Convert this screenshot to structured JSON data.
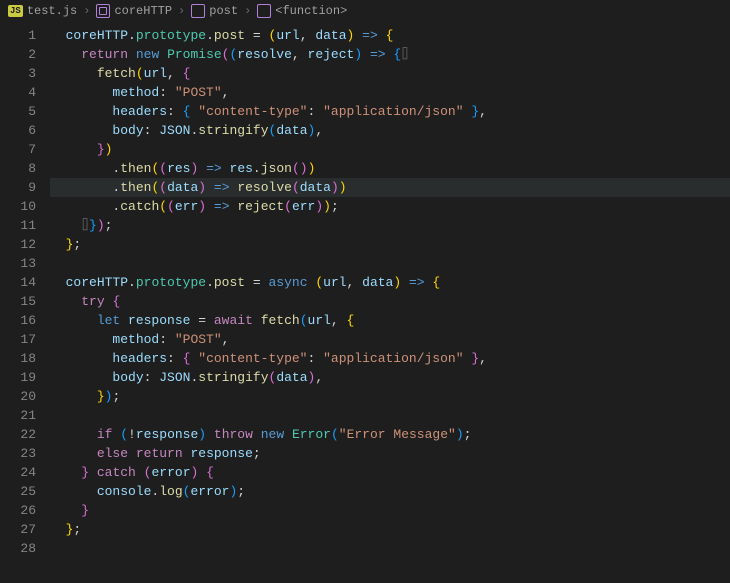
{
  "breadcrumbs": {
    "file": "test.js",
    "class": "coreHTTP",
    "method": "post",
    "fn": "<function>"
  },
  "lines": [
    "1",
    "2",
    "3",
    "4",
    "5",
    "6",
    "7",
    "8",
    "9",
    "10",
    "11",
    "12",
    "13",
    "14",
    "15",
    "16",
    "17",
    "18",
    "19",
    "20",
    "21",
    "22",
    "23",
    "24",
    "25",
    "26",
    "27",
    "28"
  ],
  "code": {
    "l1": {
      "pre": "  ",
      "tokens": [
        [
          "c-var",
          "coreHTTP"
        ],
        [
          "c-punc",
          "."
        ],
        [
          "c-type",
          "prototype"
        ],
        [
          "c-punc",
          "."
        ],
        [
          "c-fn",
          "post"
        ],
        [
          "c-op",
          " = "
        ],
        [
          "c-paren",
          "("
        ],
        [
          "c-var",
          "url"
        ],
        [
          "c-punc",
          ", "
        ],
        [
          "c-var",
          "data"
        ],
        [
          "c-paren",
          ")"
        ],
        [
          "c-kw",
          " => "
        ],
        [
          "c-paren",
          "{"
        ]
      ]
    },
    "l2": {
      "pre": "    ",
      "tokens": [
        [
          "c-ctrl",
          "return"
        ],
        [
          "c-op",
          " "
        ],
        [
          "c-kw",
          "new"
        ],
        [
          "c-op",
          " "
        ],
        [
          "c-type",
          "Promise"
        ],
        [
          "c-paren2",
          "("
        ],
        [
          "c-paren3",
          "("
        ],
        [
          "c-var",
          "resolve"
        ],
        [
          "c-punc",
          ", "
        ],
        [
          "c-var",
          "reject"
        ],
        [
          "c-paren3",
          ")"
        ],
        [
          "c-kw",
          " => "
        ],
        [
          "c-paren3",
          "{"
        ],
        [
          "hint",
          "⌷"
        ]
      ]
    },
    "l3": {
      "pre": "      ",
      "tokens": [
        [
          "c-fn",
          "fetch"
        ],
        [
          "c-paren",
          "("
        ],
        [
          "c-var",
          "url"
        ],
        [
          "c-punc",
          ", "
        ],
        [
          "c-paren2",
          "{"
        ]
      ]
    },
    "l4": {
      "pre": "        ",
      "tokens": [
        [
          "c-prop",
          "method"
        ],
        [
          "c-punc",
          ": "
        ],
        [
          "c-str",
          "\"POST\""
        ],
        [
          "c-punc",
          ","
        ]
      ]
    },
    "l5": {
      "pre": "        ",
      "tokens": [
        [
          "c-prop",
          "headers"
        ],
        [
          "c-punc",
          ": "
        ],
        [
          "c-paren3",
          "{"
        ],
        [
          "c-op",
          " "
        ],
        [
          "c-str",
          "\"content-type\""
        ],
        [
          "c-punc",
          ": "
        ],
        [
          "c-str",
          "\"application/json\""
        ],
        [
          "c-op",
          " "
        ],
        [
          "c-paren3",
          "}"
        ],
        [
          "c-punc",
          ","
        ]
      ]
    },
    "l6": {
      "pre": "        ",
      "tokens": [
        [
          "c-prop",
          "body"
        ],
        [
          "c-punc",
          ": "
        ],
        [
          "c-var",
          "JSON"
        ],
        [
          "c-punc",
          "."
        ],
        [
          "c-fn",
          "stringify"
        ],
        [
          "c-paren3",
          "("
        ],
        [
          "c-var",
          "data"
        ],
        [
          "c-paren3",
          ")"
        ],
        [
          "c-punc",
          ","
        ]
      ]
    },
    "l7": {
      "pre": "      ",
      "tokens": [
        [
          "c-paren2",
          "}"
        ],
        [
          "c-paren",
          ")"
        ]
      ]
    },
    "l8": {
      "pre": "        ",
      "tokens": [
        [
          "c-punc",
          "."
        ],
        [
          "c-fn",
          "then"
        ],
        [
          "c-paren",
          "("
        ],
        [
          "c-paren2",
          "("
        ],
        [
          "c-var",
          "res"
        ],
        [
          "c-paren2",
          ")"
        ],
        [
          "c-kw",
          " => "
        ],
        [
          "c-var",
          "res"
        ],
        [
          "c-punc",
          "."
        ],
        [
          "c-fn",
          "json"
        ],
        [
          "c-paren2",
          "("
        ],
        [
          "c-paren2",
          ")"
        ],
        [
          "c-paren",
          ")"
        ]
      ]
    },
    "l9": {
      "pre": "        ",
      "tokens": [
        [
          "c-punc",
          "."
        ],
        [
          "c-fn",
          "then"
        ],
        [
          "c-paren",
          "("
        ],
        [
          "c-paren2",
          "("
        ],
        [
          "c-var",
          "data"
        ],
        [
          "c-paren2",
          ")"
        ],
        [
          "c-kw",
          " => "
        ],
        [
          "c-fn",
          "resolve"
        ],
        [
          "c-paren2",
          "("
        ],
        [
          "c-var",
          "data"
        ],
        [
          "c-paren2",
          ")"
        ],
        [
          "c-paren",
          ")"
        ]
      ]
    },
    "l10": {
      "pre": "        ",
      "tokens": [
        [
          "c-punc",
          "."
        ],
        [
          "c-fn",
          "catch"
        ],
        [
          "c-paren",
          "("
        ],
        [
          "c-paren2",
          "("
        ],
        [
          "c-var",
          "err"
        ],
        [
          "c-paren2",
          ")"
        ],
        [
          "c-kw",
          " => "
        ],
        [
          "c-fn",
          "reject"
        ],
        [
          "c-paren2",
          "("
        ],
        [
          "c-var",
          "err"
        ],
        [
          "c-paren2",
          ")"
        ],
        [
          "c-paren",
          ")"
        ],
        [
          "c-punc",
          ";"
        ]
      ]
    },
    "l11": {
      "pre": "    ",
      "tokens": [
        [
          "hint",
          "⌷"
        ],
        [
          "c-paren3",
          "}"
        ],
        [
          "c-paren2",
          ")"
        ],
        [
          "c-punc",
          ";"
        ]
      ]
    },
    "l12": {
      "pre": "  ",
      "tokens": [
        [
          "c-paren",
          "}"
        ],
        [
          "c-punc",
          ";"
        ]
      ]
    },
    "l13": {
      "pre": "",
      "tokens": []
    },
    "l14": {
      "pre": "  ",
      "tokens": [
        [
          "c-var",
          "coreHTTP"
        ],
        [
          "c-punc",
          "."
        ],
        [
          "c-type",
          "prototype"
        ],
        [
          "c-punc",
          "."
        ],
        [
          "c-fn",
          "post"
        ],
        [
          "c-op",
          " = "
        ],
        [
          "c-kw",
          "async"
        ],
        [
          "c-op",
          " "
        ],
        [
          "c-paren",
          "("
        ],
        [
          "c-var",
          "url"
        ],
        [
          "c-punc",
          ", "
        ],
        [
          "c-var",
          "data"
        ],
        [
          "c-paren",
          ")"
        ],
        [
          "c-kw",
          " => "
        ],
        [
          "c-paren",
          "{"
        ]
      ]
    },
    "l15": {
      "pre": "    ",
      "tokens": [
        [
          "c-ctrl",
          "try"
        ],
        [
          "c-op",
          " "
        ],
        [
          "c-paren2",
          "{"
        ]
      ]
    },
    "l16": {
      "pre": "      ",
      "tokens": [
        [
          "c-kw",
          "let"
        ],
        [
          "c-op",
          " "
        ],
        [
          "c-var",
          "response"
        ],
        [
          "c-op",
          " = "
        ],
        [
          "c-ctrl",
          "await"
        ],
        [
          "c-op",
          " "
        ],
        [
          "c-fn",
          "fetch"
        ],
        [
          "c-paren3",
          "("
        ],
        [
          "c-var",
          "url"
        ],
        [
          "c-punc",
          ", "
        ],
        [
          "c-paren",
          "{"
        ]
      ]
    },
    "l17": {
      "pre": "        ",
      "tokens": [
        [
          "c-prop",
          "method"
        ],
        [
          "c-punc",
          ": "
        ],
        [
          "c-str",
          "\"POST\""
        ],
        [
          "c-punc",
          ","
        ]
      ]
    },
    "l18": {
      "pre": "        ",
      "tokens": [
        [
          "c-prop",
          "headers"
        ],
        [
          "c-punc",
          ": "
        ],
        [
          "c-paren2",
          "{"
        ],
        [
          "c-op",
          " "
        ],
        [
          "c-str",
          "\"content-type\""
        ],
        [
          "c-punc",
          ": "
        ],
        [
          "c-str",
          "\"application/json\""
        ],
        [
          "c-op",
          " "
        ],
        [
          "c-paren2",
          "}"
        ],
        [
          "c-punc",
          ","
        ]
      ]
    },
    "l19": {
      "pre": "        ",
      "tokens": [
        [
          "c-prop",
          "body"
        ],
        [
          "c-punc",
          ": "
        ],
        [
          "c-var",
          "JSON"
        ],
        [
          "c-punc",
          "."
        ],
        [
          "c-fn",
          "stringify"
        ],
        [
          "c-paren2",
          "("
        ],
        [
          "c-var",
          "data"
        ],
        [
          "c-paren2",
          ")"
        ],
        [
          "c-punc",
          ","
        ]
      ]
    },
    "l20": {
      "pre": "      ",
      "tokens": [
        [
          "c-paren",
          "}"
        ],
        [
          "c-paren3",
          ")"
        ],
        [
          "c-punc",
          ";"
        ]
      ]
    },
    "l21": {
      "pre": "",
      "tokens": []
    },
    "l22": {
      "pre": "      ",
      "tokens": [
        [
          "c-ctrl",
          "if"
        ],
        [
          "c-op",
          " "
        ],
        [
          "c-paren3",
          "("
        ],
        [
          "c-op",
          "!"
        ],
        [
          "c-var",
          "response"
        ],
        [
          "c-paren3",
          ")"
        ],
        [
          "c-op",
          " "
        ],
        [
          "c-ctrl",
          "throw"
        ],
        [
          "c-op",
          " "
        ],
        [
          "c-kw",
          "new"
        ],
        [
          "c-op",
          " "
        ],
        [
          "c-type",
          "Error"
        ],
        [
          "c-paren3",
          "("
        ],
        [
          "c-str",
          "\"Error Message\""
        ],
        [
          "c-paren3",
          ")"
        ],
        [
          "c-punc",
          ";"
        ]
      ]
    },
    "l23": {
      "pre": "      ",
      "tokens": [
        [
          "c-ctrl",
          "else"
        ],
        [
          "c-op",
          " "
        ],
        [
          "c-ctrl",
          "return"
        ],
        [
          "c-op",
          " "
        ],
        [
          "c-var",
          "response"
        ],
        [
          "c-punc",
          ";"
        ]
      ]
    },
    "l24": {
      "pre": "    ",
      "tokens": [
        [
          "c-paren2",
          "}"
        ],
        [
          "c-op",
          " "
        ],
        [
          "c-ctrl",
          "catch"
        ],
        [
          "c-op",
          " "
        ],
        [
          "c-paren2",
          "("
        ],
        [
          "c-var",
          "error"
        ],
        [
          "c-paren2",
          ")"
        ],
        [
          "c-op",
          " "
        ],
        [
          "c-paren2",
          "{"
        ]
      ]
    },
    "l25": {
      "pre": "      ",
      "tokens": [
        [
          "c-var",
          "console"
        ],
        [
          "c-punc",
          "."
        ],
        [
          "c-fn",
          "log"
        ],
        [
          "c-paren3",
          "("
        ],
        [
          "c-var",
          "error"
        ],
        [
          "c-paren3",
          ")"
        ],
        [
          "c-punc",
          ";"
        ]
      ]
    },
    "l26": {
      "pre": "    ",
      "tokens": [
        [
          "c-paren2",
          "}"
        ]
      ]
    },
    "l27": {
      "pre": "  ",
      "tokens": [
        [
          "c-paren",
          "}"
        ],
        [
          "c-punc",
          ";"
        ]
      ]
    },
    "l28": {
      "pre": "",
      "tokens": []
    }
  },
  "highlighted_line": 9
}
